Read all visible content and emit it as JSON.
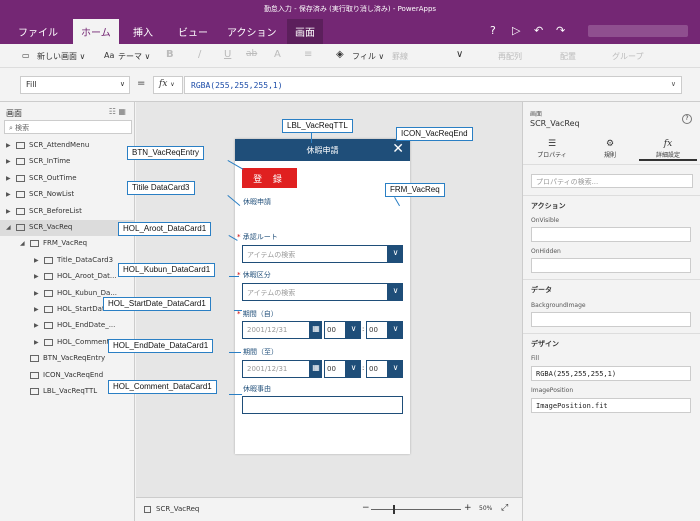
{
  "window": {
    "title": "勤怠入力 - 保存済み (実行取り消し済み) - PowerApps"
  },
  "ribbon": {
    "tabs": [
      "ファイル",
      "ホーム",
      "挿入",
      "ビュー",
      "アクション",
      "画面"
    ],
    "active_tab": "ホーム",
    "right_icons": [
      "?",
      "▷",
      "↶",
      "↷"
    ]
  },
  "toolbar": {
    "new_screen": "新しい画面",
    "theme": "テーマ",
    "bold": "B",
    "italic": "/",
    "underline": "U",
    "strike": "ab",
    "font_size": "A",
    "align": "≡",
    "fill": "フィル",
    "border": "罫線",
    "reorder": "再配列",
    "align_menu": "配置",
    "group": "グループ"
  },
  "formula_bar": {
    "property": "Fill",
    "equals": "=",
    "fx": "fx",
    "formula": "RGBA(255,255,255,1)"
  },
  "left_panel": {
    "title": "画面",
    "search_placeholder": "検索",
    "tree": [
      {
        "label": "SCR_AttendMenu",
        "level": 0,
        "expanded": false,
        "selected": false,
        "kind": "screen"
      },
      {
        "label": "SCR_InTime",
        "level": 0,
        "expanded": false,
        "selected": false,
        "kind": "screen"
      },
      {
        "label": "SCR_OutTime",
        "level": 0,
        "expanded": false,
        "selected": false,
        "kind": "screen"
      },
      {
        "label": "SCR_NowList",
        "level": 0,
        "expanded": false,
        "selected": false,
        "kind": "screen"
      },
      {
        "label": "SCR_BeforeList",
        "level": 0,
        "expanded": false,
        "selected": false,
        "kind": "screen"
      },
      {
        "label": "SCR_VacReq",
        "level": 0,
        "expanded": true,
        "selected": true,
        "kind": "screen"
      },
      {
        "label": "FRM_VacReq",
        "level": 1,
        "expanded": true,
        "selected": false,
        "kind": "form"
      },
      {
        "label": "Title_DataCard3",
        "level": 2,
        "expanded": false,
        "selected": false,
        "kind": "card"
      },
      {
        "label": "HOL_Aroot_Dat...",
        "level": 2,
        "expanded": false,
        "selected": false,
        "kind": "card"
      },
      {
        "label": "HOL_Kubun_Da...",
        "level": 2,
        "expanded": false,
        "selected": false,
        "kind": "card"
      },
      {
        "label": "HOL_StartDate...",
        "level": 2,
        "expanded": false,
        "selected": false,
        "kind": "card"
      },
      {
        "label": "HOL_EndDate_...",
        "level": 2,
        "expanded": false,
        "selected": false,
        "kind": "card"
      },
      {
        "label": "HOL_Comment...",
        "level": 2,
        "expanded": false,
        "selected": false,
        "kind": "card"
      },
      {
        "label": "BTN_VacReqEntry",
        "level": 1,
        "expanded": null,
        "selected": false,
        "kind": "button"
      },
      {
        "label": "ICON_VacReqEnd",
        "level": 1,
        "expanded": null,
        "selected": false,
        "kind": "icon"
      },
      {
        "label": "LBL_VacReqTTL",
        "level": 1,
        "expanded": null,
        "selected": false,
        "kind": "label"
      }
    ]
  },
  "form": {
    "header_title": "休暇申請",
    "close_icon": "✕",
    "register_button": "登 録",
    "title_text": "休暇申請",
    "req_mark": "*",
    "approval_label": "承認ルート",
    "approval_placeholder": "アイテムの検索",
    "kubun_label": "休暇区分",
    "kubun_placeholder": "アイテムの検索",
    "start_label": "期間（自）",
    "start_date": "2001/12/31",
    "start_hour": "00",
    "start_min": "00",
    "end_label": "期間（至）",
    "end_date": "2001/12/31",
    "end_hour": "00",
    "end_min": "00",
    "time_colon": ":",
    "comment_label": "休暇事由",
    "chevron": "∨",
    "calendar": "▦"
  },
  "callouts": {
    "lbl_ttl": "LBL_VacReqTTL",
    "icon_end": "ICON_VacReqEnd",
    "btn_entry": "BTN_VacReqEntry",
    "title_card": "Titile DataCard3",
    "frm": "FRM_VacReq",
    "aroot": "HOL_Aroot_DataCard1",
    "kubun": "HOL_Kubun_DataCard1",
    "start": "HOL_StartDate_DataCard1",
    "end": "HOL_EndDate_DataCard1",
    "comment": "HOL_Comment_DataCard1"
  },
  "right_panel": {
    "caption": "画面",
    "screen_name": "SCR_VacReq",
    "help": "?",
    "tabs": [
      {
        "label": "プロパティ",
        "icon": "☰"
      },
      {
        "label": "規則",
        "icon": "⚙"
      },
      {
        "label": "詳細設定",
        "icon": "fx"
      }
    ],
    "active_tab": "詳細設定",
    "search_placeholder": "プロパティの検索...",
    "sections": {
      "action": "アクション",
      "data": "データ",
      "design": "デザイン"
    },
    "props": {
      "on_visible_label": "OnVisible",
      "on_visible_value": "",
      "on_hidden_label": "OnHidden",
      "on_hidden_value": "",
      "bg_image_label": "BackgroundImage",
      "bg_image_value": "",
      "fill_label": "Fill",
      "fill_value": "RGBA(255,255,255,1)",
      "image_position_label": "ImagePosition",
      "image_position_value": "ImagePosition.fit"
    }
  },
  "status_bar": {
    "screen_name": "SCR_VacReq",
    "zoom_minus": "−",
    "zoom_plus": "+",
    "zoom_level": "50%",
    "zoom_fraction": 0.5,
    "expand_icon": "⤢"
  },
  "colors": {
    "ribbon": "#742774",
    "form_header": "#1f4e79",
    "register_button": "#e02020",
    "callout_border": "#2a7fc4"
  }
}
